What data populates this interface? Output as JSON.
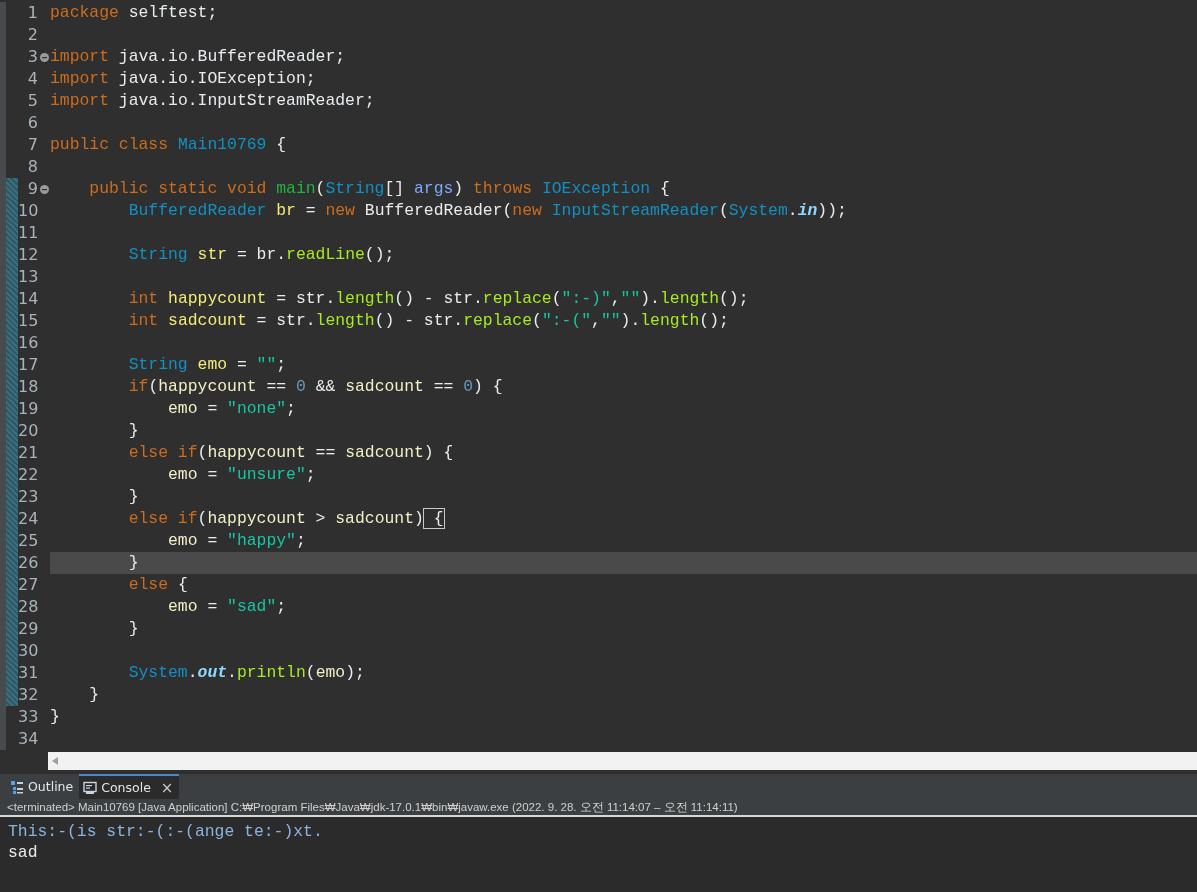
{
  "editor": {
    "lines": [
      {
        "number": "1",
        "fold": false,
        "changed": false,
        "current": false,
        "tokens": [
          {
            "text": "package ",
            "kind": "kw"
          },
          {
            "text": "selftest;",
            "kind": "plain"
          }
        ]
      },
      {
        "number": "2",
        "fold": false,
        "changed": false,
        "current": false
      },
      {
        "number": "3",
        "fold": true,
        "changed": false,
        "current": false,
        "tokens": [
          {
            "text": "import ",
            "kind": "kw"
          },
          {
            "text": "java.io.BufferedReader;",
            "kind": "plain"
          }
        ]
      },
      {
        "number": "4",
        "fold": false,
        "changed": false,
        "current": false,
        "tokens": [
          {
            "text": "import ",
            "kind": "kw"
          },
          {
            "text": "java.io.IOException;",
            "kind": "plain"
          }
        ]
      },
      {
        "number": "5",
        "fold": false,
        "changed": false,
        "current": false,
        "tokens": [
          {
            "text": "import ",
            "kind": "kw"
          },
          {
            "text": "java.io.InputStreamReader;",
            "kind": "plain"
          }
        ]
      },
      {
        "number": "6",
        "fold": false,
        "changed": false,
        "current": false
      },
      {
        "number": "7",
        "fold": false,
        "changed": false,
        "current": false,
        "tokens": [
          {
            "text": "public class ",
            "kind": "kw"
          },
          {
            "text": "Main10769",
            "kind": "type"
          },
          {
            "text": " {",
            "kind": "plain"
          }
        ]
      },
      {
        "number": "8",
        "fold": false,
        "changed": false,
        "current": false
      },
      {
        "number": "9",
        "fold": true,
        "changed": true,
        "current": false,
        "tokens": [
          {
            "text": "    public static void ",
            "kind": "kw"
          },
          {
            "text": "main",
            "kind": "decl"
          },
          {
            "text": "(",
            "kind": "plain"
          },
          {
            "text": "String",
            "kind": "type"
          },
          {
            "text": "[]",
            "kind": "plain"
          },
          {
            "text": " args",
            "kind": "param"
          },
          {
            "text": ") ",
            "kind": "plain"
          },
          {
            "text": "throws ",
            "kind": "kw"
          },
          {
            "text": "IOException",
            "kind": "type"
          },
          {
            "text": " {",
            "kind": "plain"
          }
        ]
      },
      {
        "number": "10",
        "fold": false,
        "changed": true,
        "current": false,
        "tokens": [
          {
            "text": "        BufferedReader",
            "kind": "type"
          },
          {
            "text": " br",
            "kind": "var"
          },
          {
            "text": " = ",
            "kind": "plain"
          },
          {
            "text": "new",
            "kind": "kw"
          },
          {
            "text": " BufferedReader(",
            "kind": "plain"
          },
          {
            "text": "new ",
            "kind": "kw"
          },
          {
            "text": "InputStreamReader",
            "kind": "type"
          },
          {
            "text": "(",
            "kind": "plain"
          },
          {
            "text": "System",
            "kind": "type"
          },
          {
            "text": ".",
            "kind": "plain"
          },
          {
            "text": "in",
            "kind": "field"
          },
          {
            "text": "));",
            "kind": "plain"
          }
        ]
      },
      {
        "number": "11",
        "fold": false,
        "changed": true,
        "current": false
      },
      {
        "number": "12",
        "fold": false,
        "changed": true,
        "current": false,
        "tokens": [
          {
            "text": "        String",
            "kind": "type"
          },
          {
            "text": " str",
            "kind": "var"
          },
          {
            "text": " = br.",
            "kind": "plain"
          },
          {
            "text": "readLine",
            "kind": "method"
          },
          {
            "text": "();",
            "kind": "plain"
          }
        ]
      },
      {
        "number": "13",
        "fold": false,
        "changed": true,
        "current": false
      },
      {
        "number": "14",
        "fold": false,
        "changed": true,
        "current": false,
        "tokens": [
          {
            "text": "        int ",
            "kind": "kw"
          },
          {
            "text": "happycount",
            "kind": "var"
          },
          {
            "text": " = str.",
            "kind": "plain"
          },
          {
            "text": "length",
            "kind": "method"
          },
          {
            "text": "() - str.",
            "kind": "plain"
          },
          {
            "text": "replace",
            "kind": "method"
          },
          {
            "text": "(",
            "kind": "plain"
          },
          {
            "text": "\":-)\"",
            "kind": "str"
          },
          {
            "text": ",",
            "kind": "plain"
          },
          {
            "text": "\"\"",
            "kind": "str"
          },
          {
            "text": ").",
            "kind": "plain"
          },
          {
            "text": "length",
            "kind": "method"
          },
          {
            "text": "();",
            "kind": "plain"
          }
        ]
      },
      {
        "number": "15",
        "fold": false,
        "changed": true,
        "current": false,
        "tokens": [
          {
            "text": "        int ",
            "kind": "kw"
          },
          {
            "text": "sadcount",
            "kind": "var"
          },
          {
            "text": " = str.",
            "kind": "plain"
          },
          {
            "text": "length",
            "kind": "method"
          },
          {
            "text": "() - str.",
            "kind": "plain"
          },
          {
            "text": "replace",
            "kind": "method"
          },
          {
            "text": "(",
            "kind": "plain"
          },
          {
            "text": "\":-(\"",
            "kind": "str"
          },
          {
            "text": ",",
            "kind": "plain"
          },
          {
            "text": "\"\"",
            "kind": "str"
          },
          {
            "text": ").",
            "kind": "plain"
          },
          {
            "text": "length",
            "kind": "method"
          },
          {
            "text": "();",
            "kind": "plain"
          }
        ]
      },
      {
        "number": "16",
        "fold": false,
        "changed": true,
        "current": false
      },
      {
        "number": "17",
        "fold": false,
        "changed": true,
        "current": false,
        "tokens": [
          {
            "text": "        String",
            "kind": "type"
          },
          {
            "text": " emo",
            "kind": "var"
          },
          {
            "text": " = ",
            "kind": "plain"
          },
          {
            "text": "\"\"",
            "kind": "str"
          },
          {
            "text": ";",
            "kind": "plain"
          }
        ]
      },
      {
        "number": "18",
        "fold": false,
        "changed": true,
        "current": false,
        "tokens": [
          {
            "text": "        if",
            "kind": "kw"
          },
          {
            "text": "(",
            "kind": "plain"
          },
          {
            "text": "happycount",
            "kind": "local"
          },
          {
            "text": " == ",
            "kind": "plain"
          },
          {
            "text": "0",
            "kind": "num"
          },
          {
            "text": " && ",
            "kind": "plain"
          },
          {
            "text": "sadcount",
            "kind": "local"
          },
          {
            "text": " == ",
            "kind": "plain"
          },
          {
            "text": "0",
            "kind": "num"
          },
          {
            "text": ") {",
            "kind": "plain"
          }
        ]
      },
      {
        "number": "19",
        "fold": false,
        "changed": true,
        "current": false,
        "tokens": [
          {
            "text": "            emo",
            "kind": "local"
          },
          {
            "text": " = ",
            "kind": "plain"
          },
          {
            "text": "\"none\"",
            "kind": "str"
          },
          {
            "text": ";",
            "kind": "plain"
          }
        ]
      },
      {
        "number": "20",
        "fold": false,
        "changed": true,
        "current": false,
        "tokens": [
          {
            "text": "        }",
            "kind": "plain"
          }
        ]
      },
      {
        "number": "21",
        "fold": false,
        "changed": true,
        "current": false,
        "tokens": [
          {
            "text": "        else if",
            "kind": "kw"
          },
          {
            "text": "(",
            "kind": "plain"
          },
          {
            "text": "happycount",
            "kind": "local"
          },
          {
            "text": " == ",
            "kind": "plain"
          },
          {
            "text": "sadcount",
            "kind": "local"
          },
          {
            "text": ") {",
            "kind": "plain"
          }
        ]
      },
      {
        "number": "22",
        "fold": false,
        "changed": true,
        "current": false,
        "tokens": [
          {
            "text": "            emo",
            "kind": "local"
          },
          {
            "text": " = ",
            "kind": "plain"
          },
          {
            "text": "\"unsure\"",
            "kind": "str"
          },
          {
            "text": ";",
            "kind": "plain"
          }
        ]
      },
      {
        "number": "23",
        "fold": false,
        "changed": true,
        "current": false,
        "tokens": [
          {
            "text": "        }",
            "kind": "plain"
          }
        ]
      },
      {
        "number": "24",
        "fold": false,
        "changed": true,
        "current": false,
        "tokens": [
          {
            "text": "        else if",
            "kind": "kw"
          },
          {
            "text": "(",
            "kind": "plain"
          },
          {
            "text": "happycount",
            "kind": "local"
          },
          {
            "text": " > ",
            "kind": "plain"
          },
          {
            "text": "sadcount",
            "kind": "local"
          },
          {
            "text": ")",
            "kind": "plain"
          },
          {
            "text": " {",
            "kind": "match"
          }
        ]
      },
      {
        "number": "25",
        "fold": false,
        "changed": true,
        "current": false,
        "tokens": [
          {
            "text": "            emo",
            "kind": "local"
          },
          {
            "text": " = ",
            "kind": "plain"
          },
          {
            "text": "\"happy\"",
            "kind": "str"
          },
          {
            "text": ";",
            "kind": "plain"
          }
        ]
      },
      {
        "number": "26",
        "fold": false,
        "changed": true,
        "current": true,
        "tokens": [
          {
            "text": "        }",
            "kind": "plain"
          }
        ]
      },
      {
        "number": "27",
        "fold": false,
        "changed": true,
        "current": false,
        "tokens": [
          {
            "text": "        else",
            "kind": "kw"
          },
          {
            "text": " {",
            "kind": "plain"
          }
        ]
      },
      {
        "number": "28",
        "fold": false,
        "changed": true,
        "current": false,
        "tokens": [
          {
            "text": "            emo",
            "kind": "local"
          },
          {
            "text": " = ",
            "kind": "plain"
          },
          {
            "text": "\"sad\"",
            "kind": "str"
          },
          {
            "text": ";",
            "kind": "plain"
          }
        ]
      },
      {
        "number": "29",
        "fold": false,
        "changed": true,
        "current": false,
        "tokens": [
          {
            "text": "        }",
            "kind": "plain"
          }
        ]
      },
      {
        "number": "30",
        "fold": false,
        "changed": true,
        "current": false
      },
      {
        "number": "31",
        "fold": false,
        "changed": true,
        "current": false,
        "tokens": [
          {
            "text": "        System",
            "kind": "type"
          },
          {
            "text": ".",
            "kind": "plain"
          },
          {
            "text": "out",
            "kind": "field"
          },
          {
            "text": ".",
            "kind": "plain"
          },
          {
            "text": "println",
            "kind": "method"
          },
          {
            "text": "(",
            "kind": "plain"
          },
          {
            "text": "emo",
            "kind": "local"
          },
          {
            "text": ");",
            "kind": "plain"
          }
        ]
      },
      {
        "number": "32",
        "fold": false,
        "changed": true,
        "current": false,
        "tokens": [
          {
            "text": "    }",
            "kind": "plain"
          }
        ]
      },
      {
        "number": "33",
        "fold": false,
        "changed": false,
        "current": false,
        "tokens": [
          {
            "text": "}",
            "kind": "plain"
          }
        ]
      },
      {
        "number": "34",
        "fold": false,
        "changed": false,
        "current": false
      }
    ]
  },
  "views": {
    "tabs": [
      {
        "label": "Outline",
        "selected": false,
        "closable": false
      },
      {
        "label": "Console",
        "selected": true,
        "closable": true
      }
    ]
  },
  "close_glyph": "×",
  "console": {
    "status": "<terminated> Main10769 [Java Application] C:₩Program Files₩Java₩jdk-17.0.1₩bin₩javaw.exe  (2022. 9. 28. 오전 11:14:07 – 오전 11:14:11)",
    "output": [
      {
        "text": "This:-(is str:-(:-(ange te:-)xt.",
        "kind": "input"
      },
      {
        "text": "sad",
        "kind": "output"
      }
    ]
  }
}
